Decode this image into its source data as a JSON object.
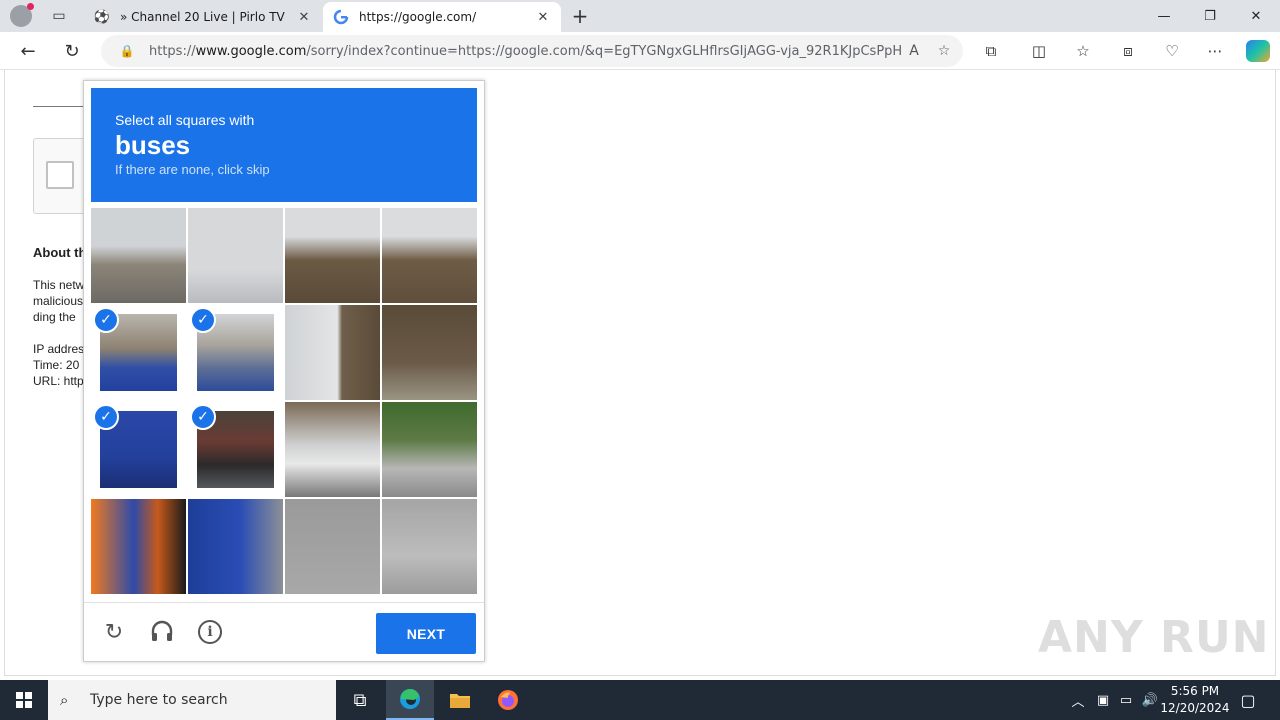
{
  "browser": {
    "tabs": [
      {
        "title": "» Channel 20 Live | Pirlo TV",
        "favicon": "soccer-ball-icon"
      },
      {
        "title": "https://google.com/",
        "favicon": "google-g-icon"
      }
    ],
    "url_prefix": "https://",
    "url_domain": "www.google.com",
    "url_rest": "/sorry/index?continue=https://google.com/&q=EgTYGNgxGLHflrsGIjAGG-vja_92R1KJpCsPpH..."
  },
  "background_page": {
    "about_heading": "About th",
    "lines": [
      "This netw",
      "malicious",
      "ding the",
      "IP addres",
      "Time: 20",
      "URL: http"
    ]
  },
  "captcha": {
    "instruction": "Select all squares with",
    "target": "buses",
    "hint": "If there are none, click skip",
    "next_label": "NEXT",
    "selected_tiles": [
      4,
      5,
      8,
      9
    ],
    "accent_color": "#1a73e8"
  },
  "watermark": "ANY RUN",
  "taskbar": {
    "search_placeholder": "Type here to search",
    "time": "5:56 PM",
    "date": "12/20/2024"
  }
}
